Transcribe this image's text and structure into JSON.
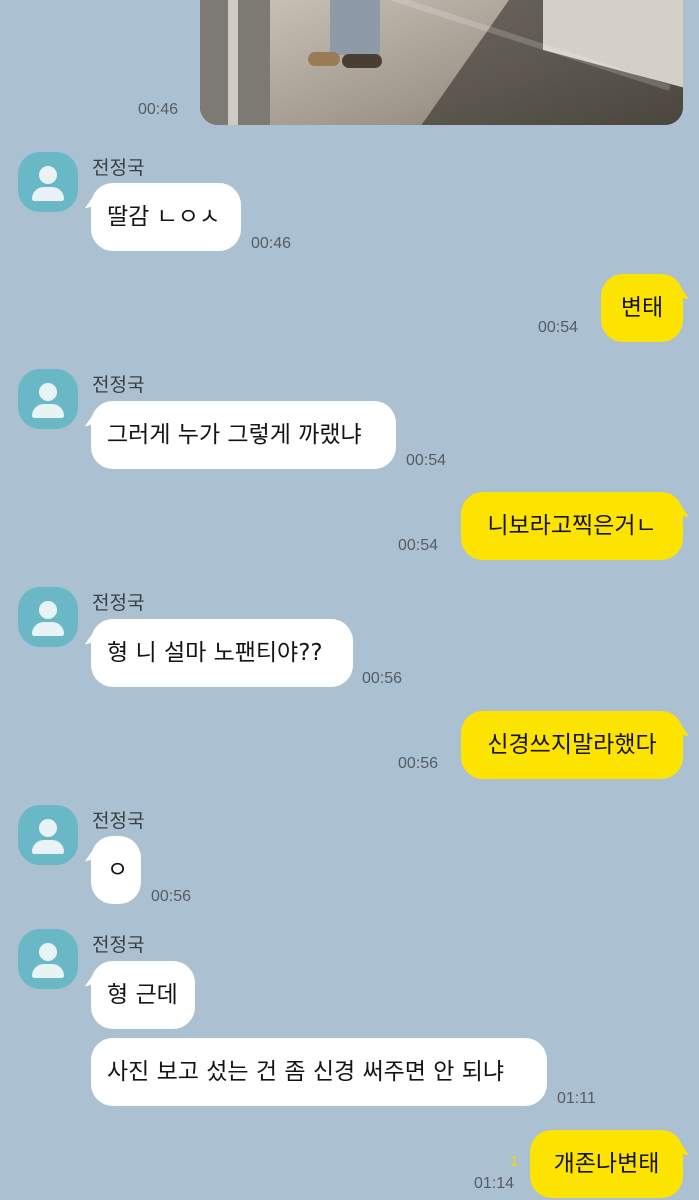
{
  "colors": {
    "background": "#abc1d1",
    "incoming_bubble": "#ffffff",
    "outgoing_bubble": "#fde400",
    "avatar": "#6ab7c6",
    "unread": "#f5d70a"
  },
  "photo_message": {
    "time": "00:46",
    "icon": "photo-message"
  },
  "conversation": {
    "contact_name": "전정국",
    "messages": [
      {
        "from": "contact",
        "text": "딸감 ㄴㅇㅅ",
        "time": "00:46"
      },
      {
        "from": "me",
        "text": "변태",
        "time": "00:54"
      },
      {
        "from": "contact",
        "text": "그러게 누가 그렇게 까랬냐",
        "time": "00:54"
      },
      {
        "from": "me",
        "text": "니보라고찍은거ㄴ",
        "time": "00:54"
      },
      {
        "from": "contact",
        "text": "형 니 설마 노팬티야??",
        "time": "00:56"
      },
      {
        "from": "me",
        "text": "신경쓰지말라했다",
        "time": "00:56"
      },
      {
        "from": "contact",
        "text": "ㅇ",
        "time": "00:56"
      },
      {
        "from": "contact",
        "text": "형 근데",
        "time": ""
      },
      {
        "from": "contact",
        "text": "사진 보고 섰는 건 좀 신경 써주면 안 되냐",
        "time": "01:11"
      },
      {
        "from": "me",
        "text": "개존나변태",
        "time": "01:14",
        "unread": "1"
      }
    ]
  }
}
